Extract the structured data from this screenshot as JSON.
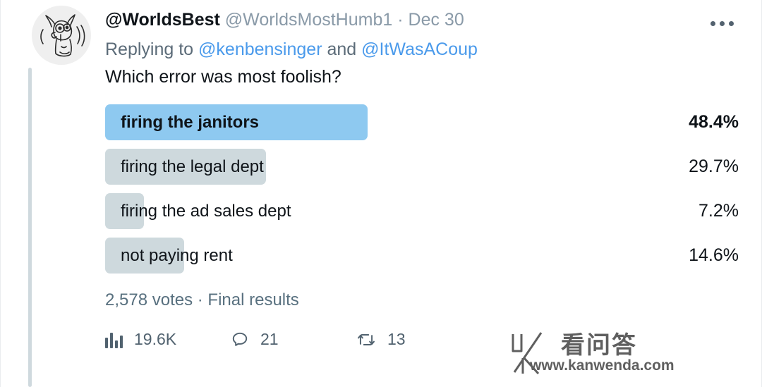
{
  "tweet": {
    "display_name": "@WorldsBest",
    "handle": "@WorldsMostHumb1",
    "separator": "·",
    "date": "Dec 30",
    "more_label": "More",
    "replying_prefix": "Replying to",
    "reply_to_1": "@kenbensinger",
    "reply_conjunction": "and",
    "reply_to_2": "@ItWasACoup",
    "question": "Which error was most foolish?"
  },
  "poll": {
    "options": [
      {
        "label": "firing the janitors",
        "percent": "48.4%",
        "value": 48.4,
        "winner": true
      },
      {
        "label": "firing the legal dept",
        "percent": "29.7%",
        "value": 29.7,
        "winner": false
      },
      {
        "label": "firing the ad sales dept",
        "percent": "7.2%",
        "value": 7.2,
        "winner": false
      },
      {
        "label": "not paying rent",
        "percent": "14.6%",
        "value": 14.6,
        "winner": false
      }
    ],
    "meta": "2,578 votes · Final results",
    "winner_color": "#8ec9f0",
    "bar_color": "#ced9dd"
  },
  "actions": [
    {
      "icon": "analytics-icon",
      "count": "19.6K"
    },
    {
      "icon": "reply-icon",
      "count": "21"
    },
    {
      "icon": "retweet-icon",
      "count": "13"
    }
  ],
  "watermark": {
    "logo": "k-logo-icon",
    "cn_text": "看问答",
    "url": "www.kanwenda.com"
  }
}
